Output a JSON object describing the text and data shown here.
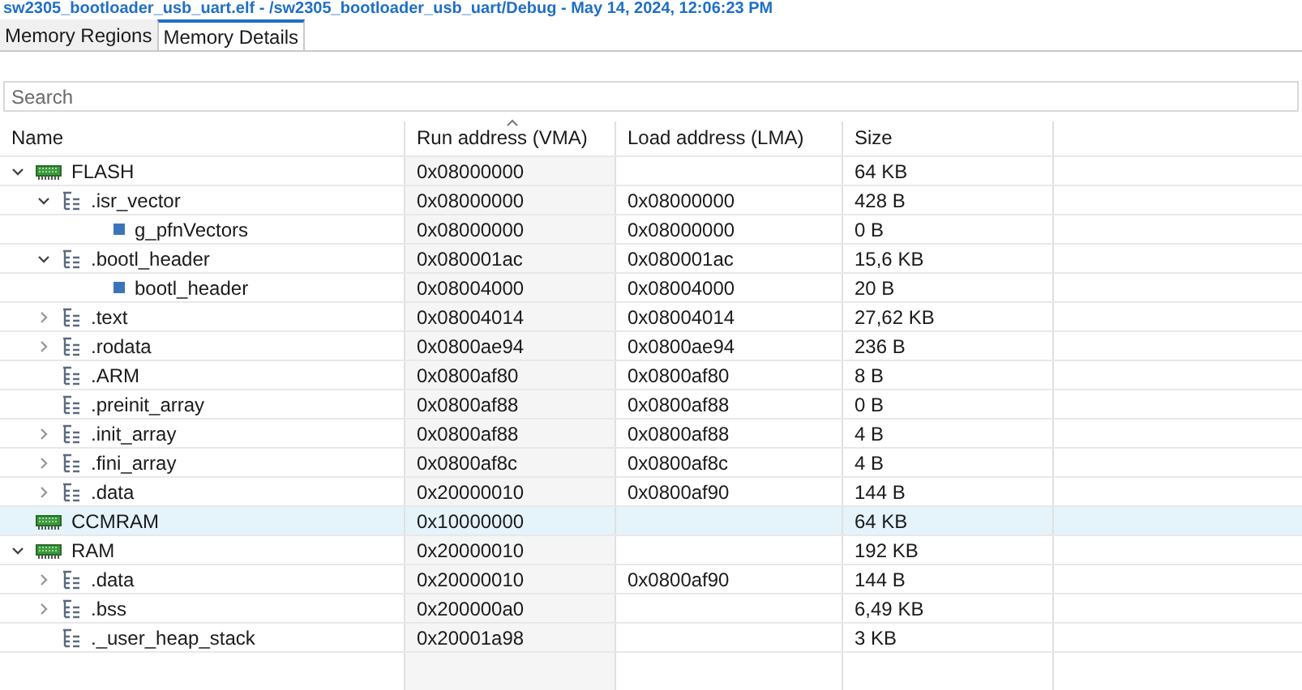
{
  "header_title": "sw2305_bootloader_usb_uart.elf - /sw2305_bootloader_usb_uart/Debug - May 14, 2024, 12:06:23 PM",
  "tabs": [
    {
      "label": "Memory Regions",
      "selected": false
    },
    {
      "label": "Memory Details",
      "selected": true
    }
  ],
  "search": {
    "placeholder": "Search"
  },
  "table": {
    "columns": [
      "Name",
      "Run address (VMA)",
      "Load address (LMA)",
      "Size"
    ],
    "rows": [
      {
        "kind": "region",
        "name": "FLASH",
        "vma": "0x08000000",
        "size": "64 KB",
        "expanded": true,
        "selected": false,
        "children": [
          {
            "kind": "section",
            "name": ".isr_vector",
            "vma": "0x08000000",
            "lma": "0x08000000",
            "size": "428 B",
            "expanded": true,
            "selected": false,
            "children": [
              {
                "kind": "symbol",
                "name": "g_pfnVectors",
                "vma": "0x08000000",
                "lma": "0x08000000",
                "size": "0 B",
                "selected": false
              }
            ]
          },
          {
            "kind": "section",
            "name": ".bootl_header",
            "vma": "0x080001ac",
            "lma": "0x080001ac",
            "size": "15,6 KB",
            "expanded": true,
            "selected": false,
            "children": [
              {
                "kind": "symbol",
                "name": "bootl_header",
                "vma": "0x08004000",
                "lma": "0x08004000",
                "size": "20 B",
                "selected": false
              }
            ]
          },
          {
            "kind": "section",
            "name": ".text",
            "vma": "0x08004014",
            "lma": "0x08004014",
            "size": "27,62 KB",
            "expanded": false,
            "selected": false
          },
          {
            "kind": "section",
            "name": ".rodata",
            "vma": "0x0800ae94",
            "lma": "0x0800ae94",
            "size": "236 B",
            "expanded": false,
            "selected": false
          },
          {
            "kind": "section",
            "name": ".ARM",
            "vma": "0x0800af80",
            "lma": "0x0800af80",
            "size": "8 B",
            "selected": false
          },
          {
            "kind": "section",
            "name": ".preinit_array",
            "vma": "0x0800af88",
            "lma": "0x0800af88",
            "size": "0 B",
            "selected": false
          },
          {
            "kind": "section",
            "name": ".init_array",
            "vma": "0x0800af88",
            "lma": "0x0800af88",
            "size": "4 B",
            "expanded": false,
            "selected": false
          },
          {
            "kind": "section",
            "name": ".fini_array",
            "vma": "0x0800af8c",
            "lma": "0x0800af8c",
            "size": "4 B",
            "expanded": false,
            "selected": false
          },
          {
            "kind": "section",
            "name": ".data",
            "vma": "0x20000010",
            "lma": "0x0800af90",
            "size": "144 B",
            "expanded": false,
            "selected": false
          }
        ]
      },
      {
        "kind": "region",
        "name": "CCMRAM",
        "vma": "0x10000000",
        "size": "64 KB",
        "selected": true
      },
      {
        "kind": "region",
        "name": "RAM",
        "vma": "0x20000010",
        "size": "192 KB",
        "expanded": true,
        "selected": false,
        "children": [
          {
            "kind": "section",
            "name": ".data",
            "vma": "0x20000010",
            "lma": "0x0800af90",
            "size": "144 B",
            "expanded": false,
            "selected": false
          },
          {
            "kind": "section",
            "name": ".bss",
            "vma": "0x200000a0",
            "size": "6,49 KB",
            "expanded": false,
            "selected": false
          },
          {
            "kind": "section",
            "name": "._user_heap_stack",
            "vma": "0x20001a98",
            "size": "3 KB",
            "selected": false
          }
        ]
      }
    ]
  }
}
